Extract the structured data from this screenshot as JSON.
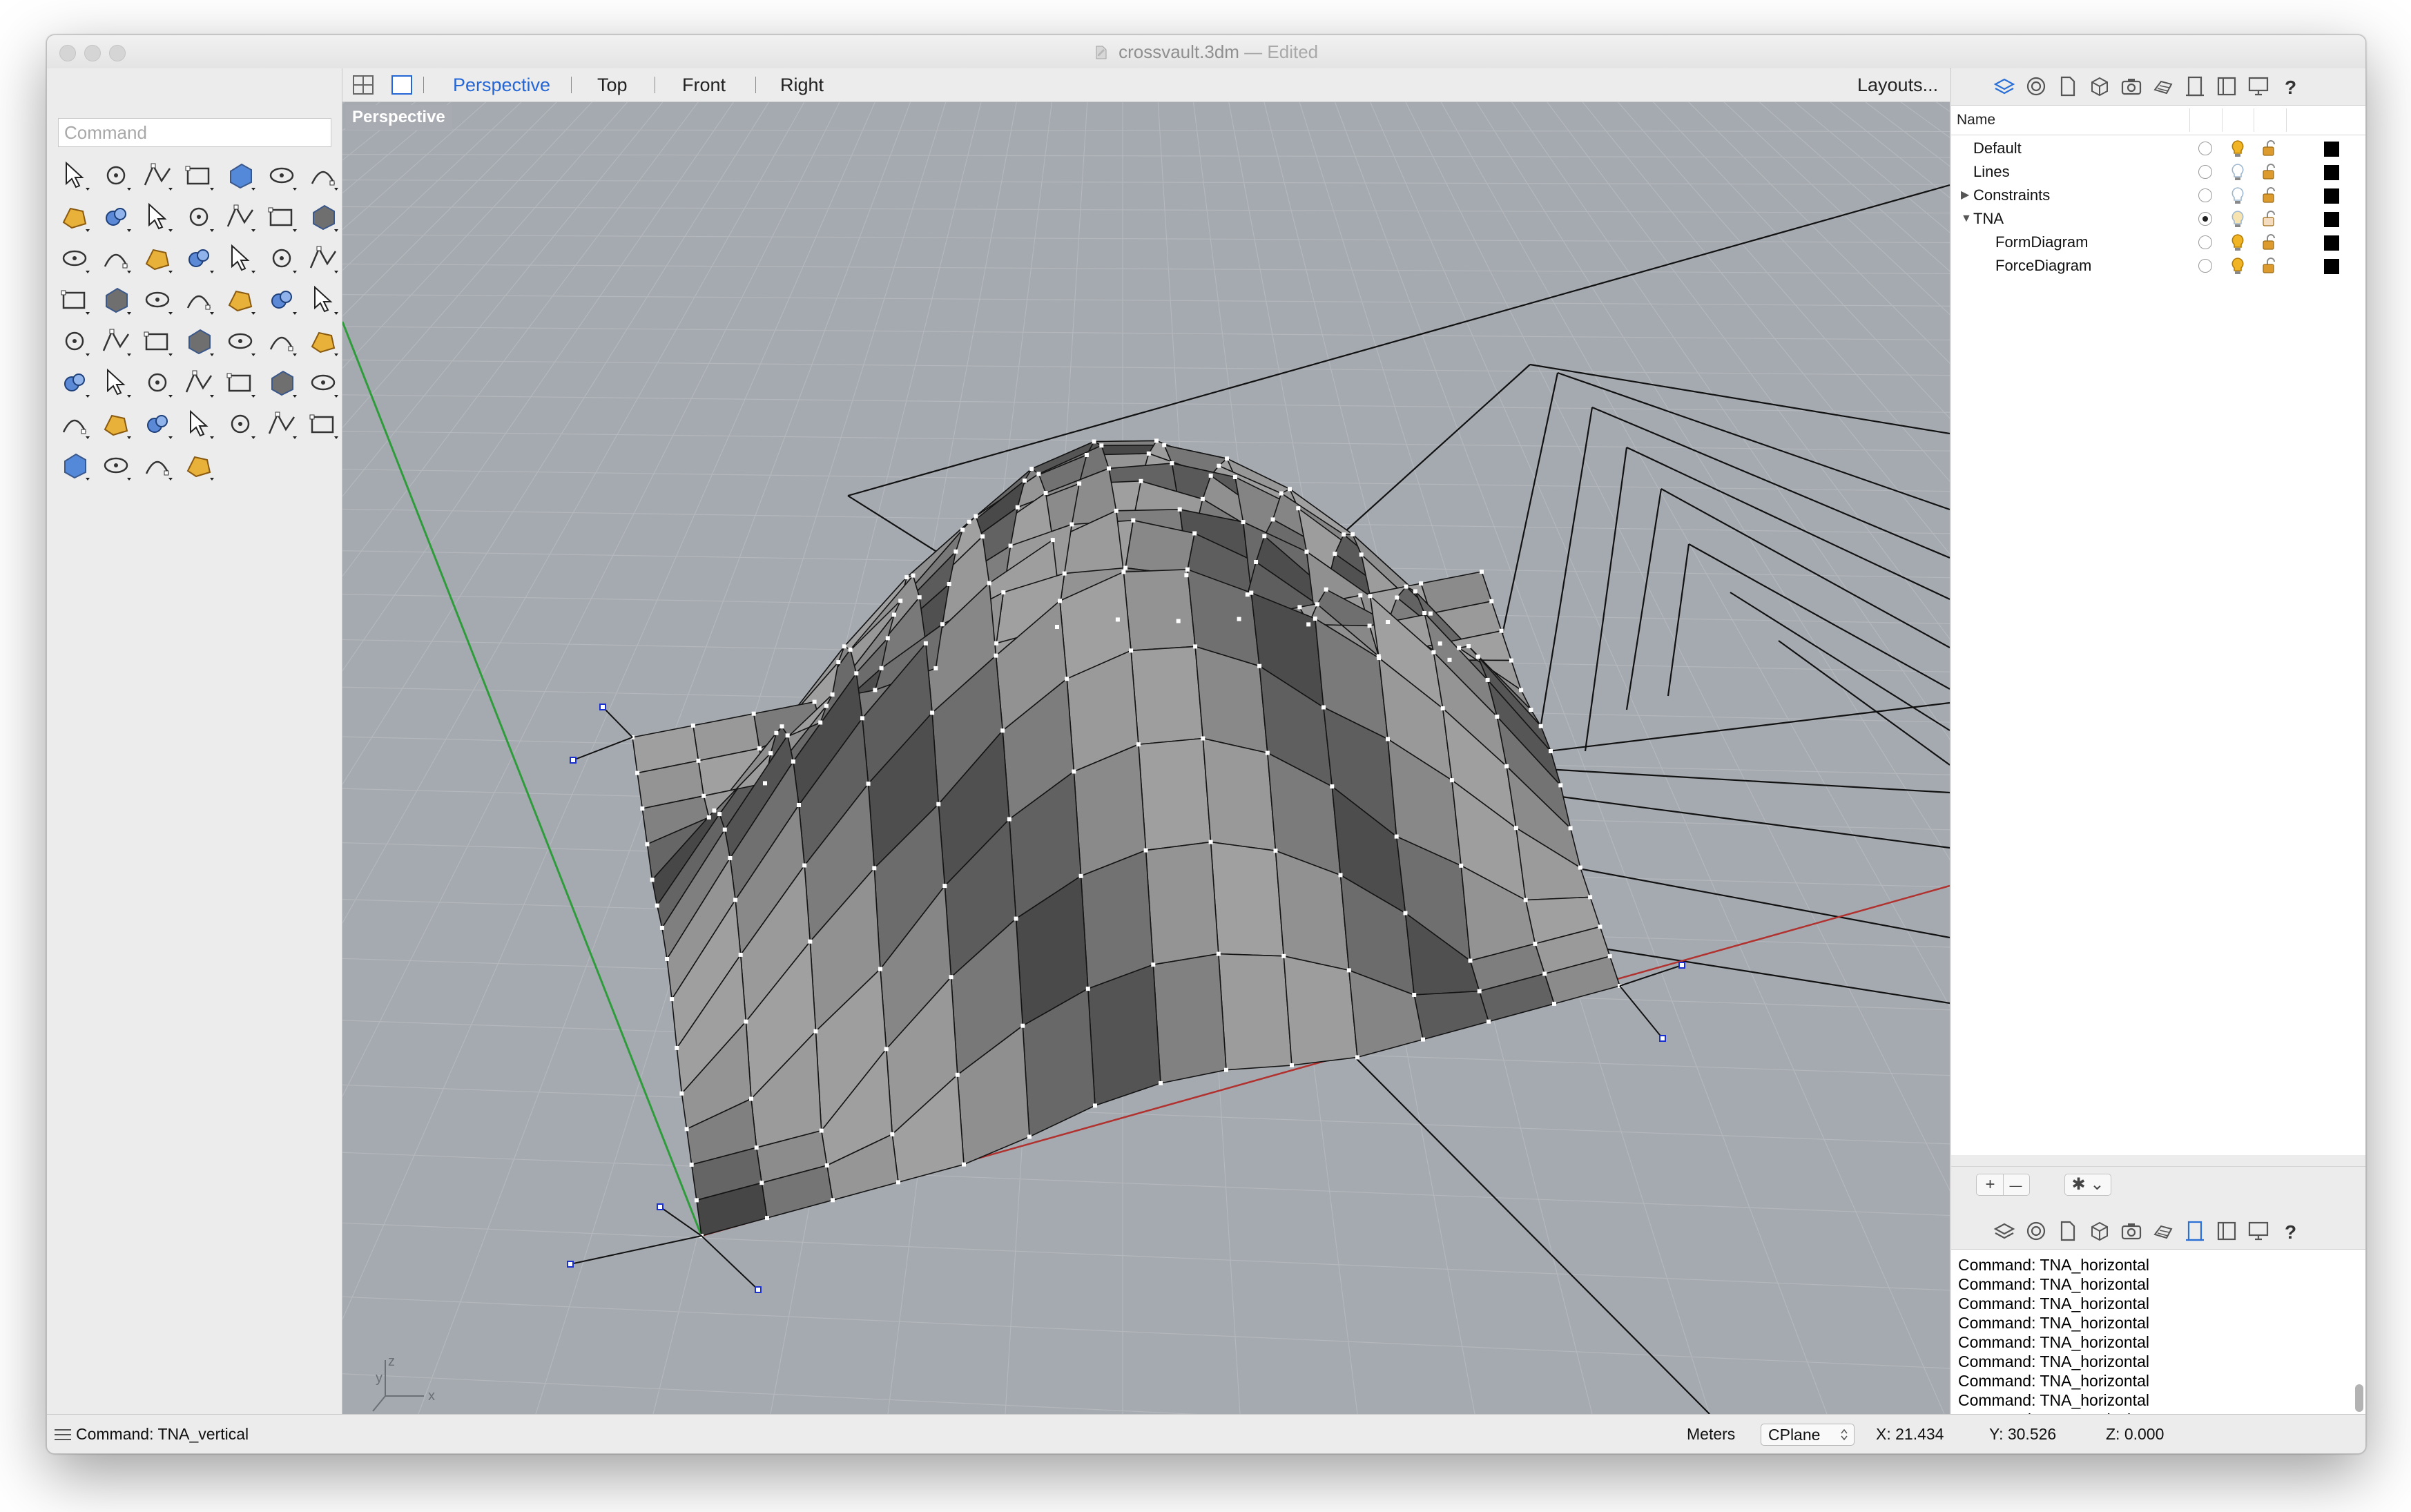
{
  "window": {
    "title": "crossvault.3dm",
    "title_status": "— Edited"
  },
  "command": {
    "placeholder": "Command"
  },
  "toolbar_icons": [
    "select-arrow-icon",
    "point-icon",
    "polyline-icon",
    "curve-icon",
    "circle-icon",
    "ellipse-icon",
    "arc-icon",
    "rectangle-icon",
    "polygon-icon",
    "fillet-icon",
    "surface-points-icon",
    "loft-icon",
    "box-icon",
    "boolean-icon",
    "cylinder-icon",
    "plane-icon",
    "gear-icon",
    "explode-icon",
    "extend-icon",
    "split-icon",
    "sphere-color-icon",
    "points-icon",
    "curve-tool-icon",
    "blend-icon",
    "text-icon",
    "scale-icon",
    "array-icon",
    "project-icon",
    "box-blue-icon",
    "dimension-icon",
    "grid-array-icon",
    "gumball-icon",
    "surface-edit-icon",
    "check-icon",
    "bend-icon",
    "paint-bucket-icon",
    "zoom-icon",
    "zoom-window-icon",
    "zoom-extents-icon",
    "zoom-selected-icon",
    "rotate-view-icon",
    "car-icon",
    "texture-map-icon",
    "point-snap-icon",
    "light-icon",
    "lock-icon",
    "color-flag-icon",
    "color-wheel-icon",
    "globe-wire-icon",
    "world-icon",
    "render-sphere-icon",
    "pencil-icon",
    "dimension-tool-icon"
  ],
  "viewport_tabs": {
    "perspective": "Perspective",
    "top": "Top",
    "front": "Front",
    "right": "Right",
    "layouts": "Layouts..."
  },
  "viewport": {
    "label": "Perspective",
    "axis_x": "x",
    "axis_y": "y",
    "axis_z": "z",
    "background_color": "#a5aab0",
    "x_axis_color": "#b0312e",
    "y_axis_color": "#2e9c3a"
  },
  "layers": {
    "header_name": "Name",
    "rows": [
      {
        "name": "Default",
        "expander": "",
        "current": false,
        "light_on": true,
        "locked": true
      },
      {
        "name": "Lines",
        "expander": "",
        "current": false,
        "light_on": false,
        "locked": true
      },
      {
        "name": "Constraints",
        "expander": "▶",
        "current": false,
        "light_on": false,
        "locked": true
      },
      {
        "name": "TNA",
        "expander": "▼",
        "current": true,
        "light_on": false,
        "locked": false
      },
      {
        "name": "FormDiagram",
        "expander": "",
        "current": false,
        "light_on": true,
        "locked": true
      },
      {
        "name": "ForceDiagram",
        "expander": "",
        "current": false,
        "light_on": true,
        "locked": true
      }
    ],
    "add_label": "+",
    "remove_label": "—",
    "options_label": "✱ ⌄"
  },
  "panel_tab_icons": [
    "layers-icon",
    "properties-icon",
    "document-icon",
    "object-icon",
    "camera-icon",
    "materials-icon",
    "print-icon",
    "panel-icon",
    "display-icon",
    "help-icon"
  ],
  "history": [
    "Command: TNA_horizontal",
    "Command: TNA_horizontal",
    "Command: TNA_horizontal",
    "Command: TNA_horizontal",
    "Command: TNA_horizontal",
    "Command: TNA_horizontal",
    "Command: TNA_horizontal",
    "Command: TNA_horizontal",
    "Command: TNA_vertical"
  ],
  "status": {
    "last_command": "Command: TNA_vertical",
    "units": "Meters",
    "cplane": "CPlane",
    "x": "X: 21.434",
    "y": "Y: 30.526",
    "z": "Z: 0.000"
  }
}
